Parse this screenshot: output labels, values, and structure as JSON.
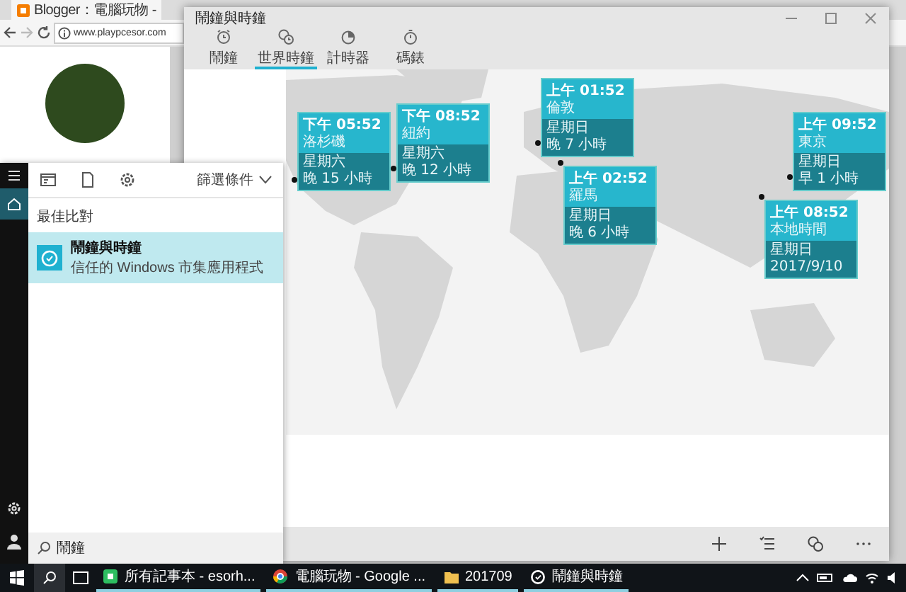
{
  "browser": {
    "tabs": [
      {
        "title": "Blogger：電腦玩物 -",
        "selected": true
      }
    ],
    "address": "www.playpcesor.com"
  },
  "clock_app": {
    "title": "鬧鐘與時鐘",
    "tabs": [
      {
        "label": "鬧鐘",
        "selected": false
      },
      {
        "label": "世界時鐘",
        "selected": true
      },
      {
        "label": "計時器",
        "selected": false
      },
      {
        "label": "碼錶",
        "selected": false
      }
    ],
    "cities": [
      {
        "time": "下午 05:52",
        "city": "洛杉磯",
        "day": "星期六",
        "offset": "晚 15 小時"
      },
      {
        "time": "下午 08:52",
        "city": "紐約",
        "day": "星期六",
        "offset": "晚 12 小時"
      },
      {
        "time": "上午 01:52",
        "city": "倫敦",
        "day": "星期日",
        "offset": "晚 7 小時"
      },
      {
        "time": "上午 02:52",
        "city": "羅馬",
        "day": "星期日",
        "offset": "晚 6 小時"
      },
      {
        "time": "上午 09:52",
        "city": "東京",
        "day": "星期日",
        "offset": "早 1 小時"
      },
      {
        "time": "上午 08:52",
        "city": "本地時間",
        "day": "星期日",
        "offset": "2017/9/10"
      }
    ]
  },
  "start_menu": {
    "filter_label": "篩選條件",
    "section": "最佳比對",
    "results": [
      {
        "name": "鬧鐘與時鐘",
        "description": "信任的 Windows 市集應用程式",
        "selected": true
      }
    ],
    "search": {
      "value": "鬧鐘"
    }
  },
  "taskbar": {
    "items": [
      {
        "label": "所有記事本 - esorh..."
      },
      {
        "label": "電腦玩物 - Google ..."
      },
      {
        "label": "201709"
      },
      {
        "label": "鬧鐘與時鐘"
      }
    ]
  }
}
